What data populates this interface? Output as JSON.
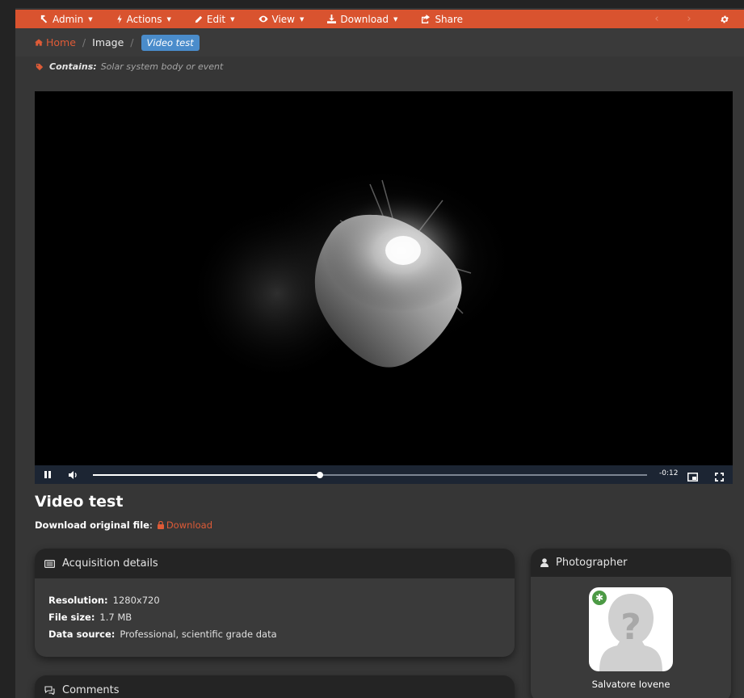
{
  "toolbar": {
    "items": [
      {
        "label": "Admin",
        "icon": "hammer-icon",
        "dropdown": true
      },
      {
        "label": "Actions",
        "icon": "bolt-icon",
        "dropdown": true
      },
      {
        "label": "Edit",
        "icon": "pencil-icon",
        "dropdown": true
      },
      {
        "label": "View",
        "icon": "eye-icon",
        "dropdown": true
      },
      {
        "label": "Download",
        "icon": "download-icon",
        "dropdown": true
      },
      {
        "label": "Share",
        "icon": "share-icon",
        "dropdown": false
      }
    ],
    "prev_label": "‹",
    "next_label": "›",
    "accent": "#d9532f"
  },
  "breadcrumb": {
    "home": "Home",
    "section": "Image",
    "current": "Video test"
  },
  "contains": {
    "label": "Contains:",
    "value": "Solar system body or event"
  },
  "video": {
    "time_remaining": "-0:12",
    "progress_fraction": 0.41,
    "state": "playing"
  },
  "image": {
    "title": "Video test",
    "download_label": "Download original file",
    "download_colon": ":",
    "download_link": "Download"
  },
  "acquisition": {
    "heading": "Acquisition details",
    "rows": [
      {
        "label": "Resolution:",
        "value": "1280x720"
      },
      {
        "label": "File size:",
        "value": "1.7 MB"
      },
      {
        "label": "Data source:",
        "value": "Professional, scientific grade data"
      }
    ]
  },
  "photographer": {
    "heading": "Photographer",
    "name": "Salvatore Iovene",
    "badge": "✱"
  },
  "comments": {
    "heading": "Comments"
  }
}
